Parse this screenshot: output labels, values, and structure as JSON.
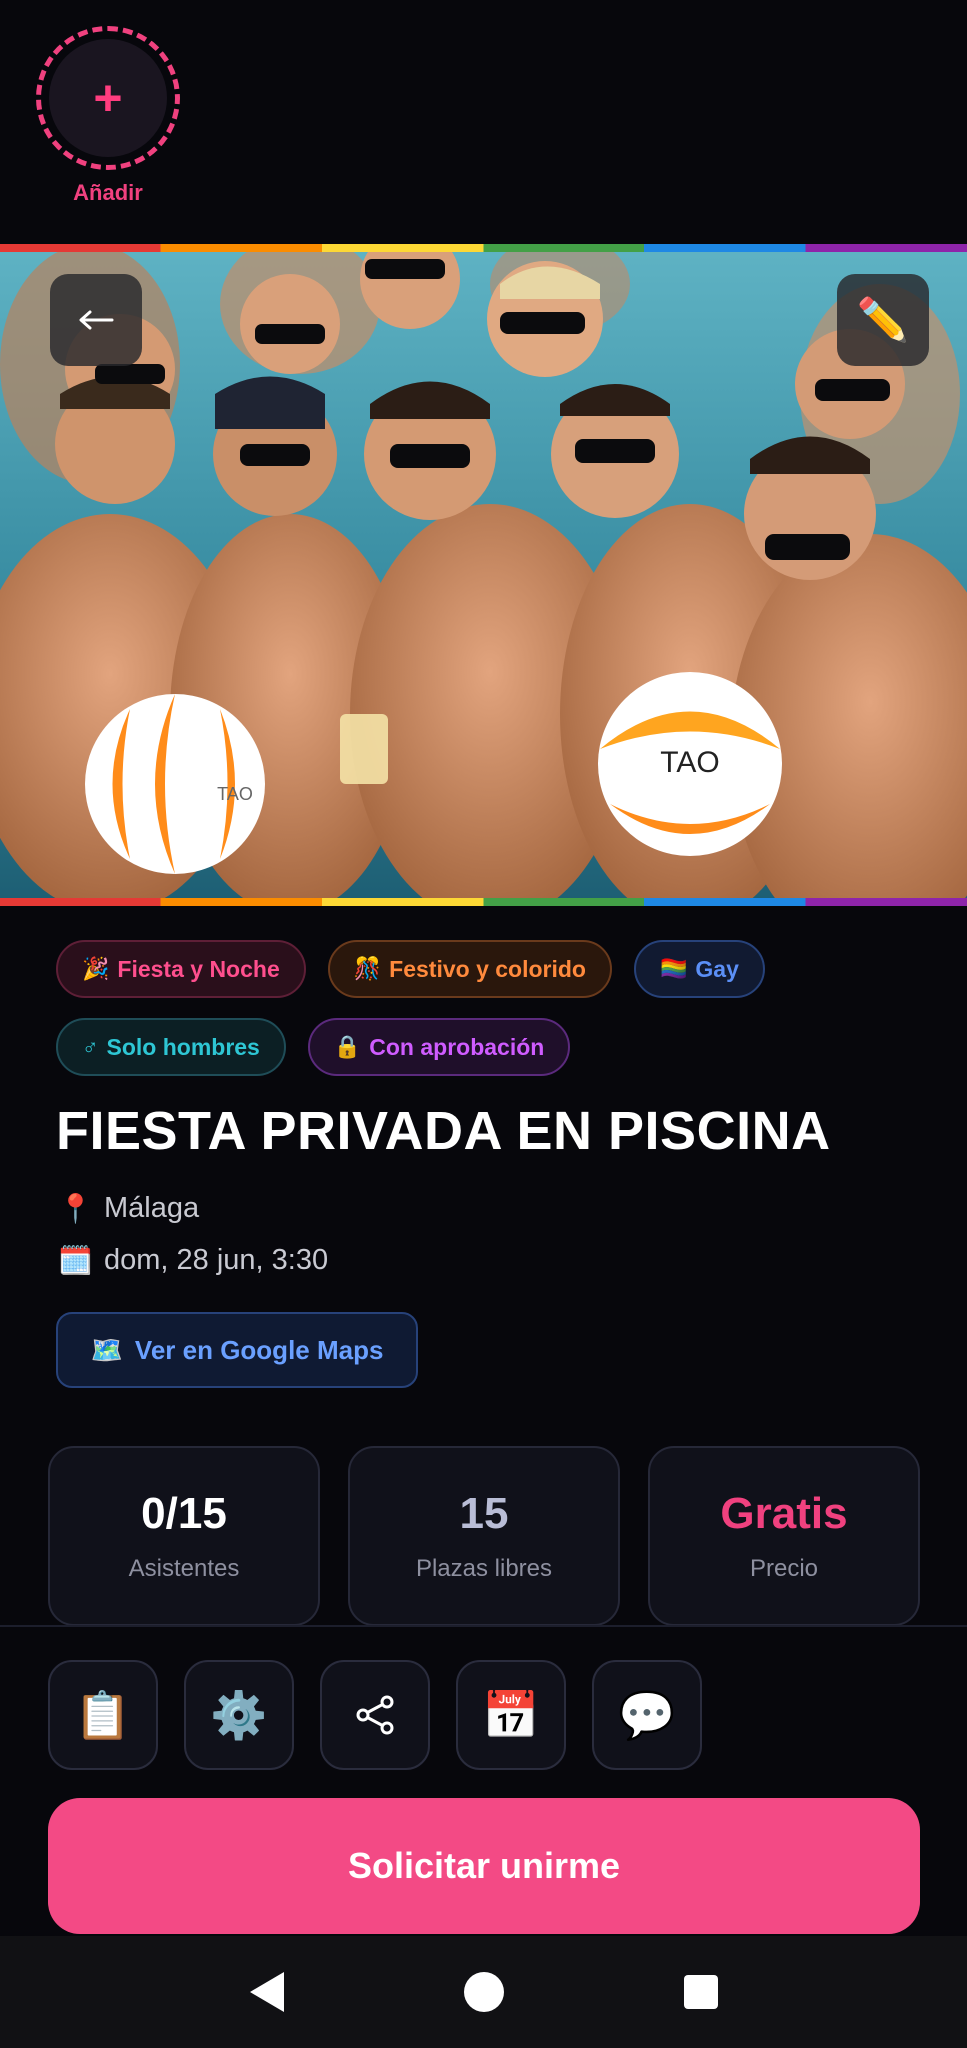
{
  "story": {
    "add_symbol": "+",
    "add_label": "Añadir"
  },
  "hero": {
    "back_symbol": "←",
    "edit_symbol": "✏️",
    "ball_left_text": "TAO",
    "ball_right_text": "TAO"
  },
  "chips": [
    {
      "emoji": "🎉",
      "label": "Fiesta y Noche",
      "color": "#ff4f8e"
    },
    {
      "emoji": "🎊",
      "label": "Festivo y colorido",
      "color": "#ff8a3d"
    },
    {
      "emoji": "🏳️‍🌈",
      "label": "Gay",
      "color": "#5b8ff6"
    },
    {
      "emoji": "♂",
      "label": "Solo hombres",
      "color": "#2ec6d4"
    },
    {
      "emoji": "🔒",
      "label": "Con aprobación",
      "color": "#cf5cff"
    }
  ],
  "event": {
    "title": "FIESTA PRIVADA EN PISCINA",
    "location_icon": "📍",
    "location": "Málaga",
    "date_icon": "🗓️",
    "date": "dom, 28 jun, 3:30",
    "maps_icon": "🗺️",
    "maps_label": "Ver en Google Maps"
  },
  "stats": [
    {
      "value": "0/15",
      "label": "Asistentes",
      "color": "#ffffff"
    },
    {
      "value": "15",
      "label": "Plazas libres",
      "color": "#b9bdd6"
    },
    {
      "value": "Gratis",
      "label": "Precio",
      "color": "#f0417f"
    }
  ],
  "actions": [
    {
      "name": "clipboard-icon",
      "glyph": "📋"
    },
    {
      "name": "settings-icon",
      "glyph": "⚙️"
    },
    {
      "name": "share-icon",
      "glyph": "share"
    },
    {
      "name": "calendar-icon",
      "glyph": "📅"
    },
    {
      "name": "chat-icon",
      "glyph": "💬"
    }
  ],
  "join_label": "Solicitar unirme",
  "colors": {
    "accent": "#f34a85",
    "background": "#07070c"
  }
}
